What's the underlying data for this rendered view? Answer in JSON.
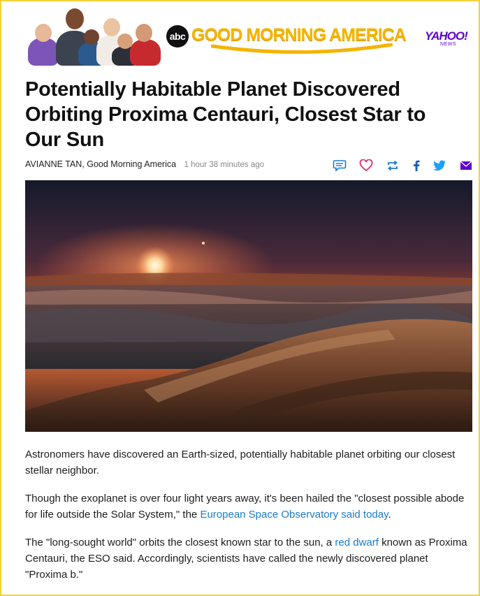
{
  "banner": {
    "abc_logo": "abc",
    "show_title": "GOOD MORNING AMERICA",
    "partner_logo": "YAHOO!",
    "partner_sub": "NEWS"
  },
  "article": {
    "headline": "Potentially Habitable Planet Discovered Orbiting Proxima Centauri, Closest Star to Our Sun",
    "author": "AVIANNE TAN,",
    "source": "Good Morning America",
    "time_ago": "1 hour 38 minutes ago",
    "paragraphs": [
      {
        "text": "Astronomers have discovered an Earth-sized, potentially habitable planet orbiting our closest stellar neighbor."
      },
      {
        "before": "Though the exoplanet is over four light years away, it's been hailed the \"closest possible abode for life outside the Solar System,\" the ",
        "link": "European Space Observatory said today",
        "after": "."
      },
      {
        "before": "The \"long-sought world\" orbits the closest known star to the sun, a ",
        "link": "red dwarf",
        "after": " known as Proxima Centauri, the ESO said. Accordingly, scientists have called the newly discovered planet \"Proxima b.\""
      }
    ]
  },
  "share_icons": [
    "comment-icon",
    "heart-icon",
    "retweet-icon",
    "facebook-icon",
    "twitter-icon",
    "mail-icon"
  ],
  "colors": {
    "frame_border": "#f2d23a",
    "gma_gold": "#f4b400",
    "yahoo_purple": "#5f01d1",
    "link_blue": "#1a7bd0",
    "share_blue": "#1a7bd0",
    "heart_red": "#e0245e"
  }
}
